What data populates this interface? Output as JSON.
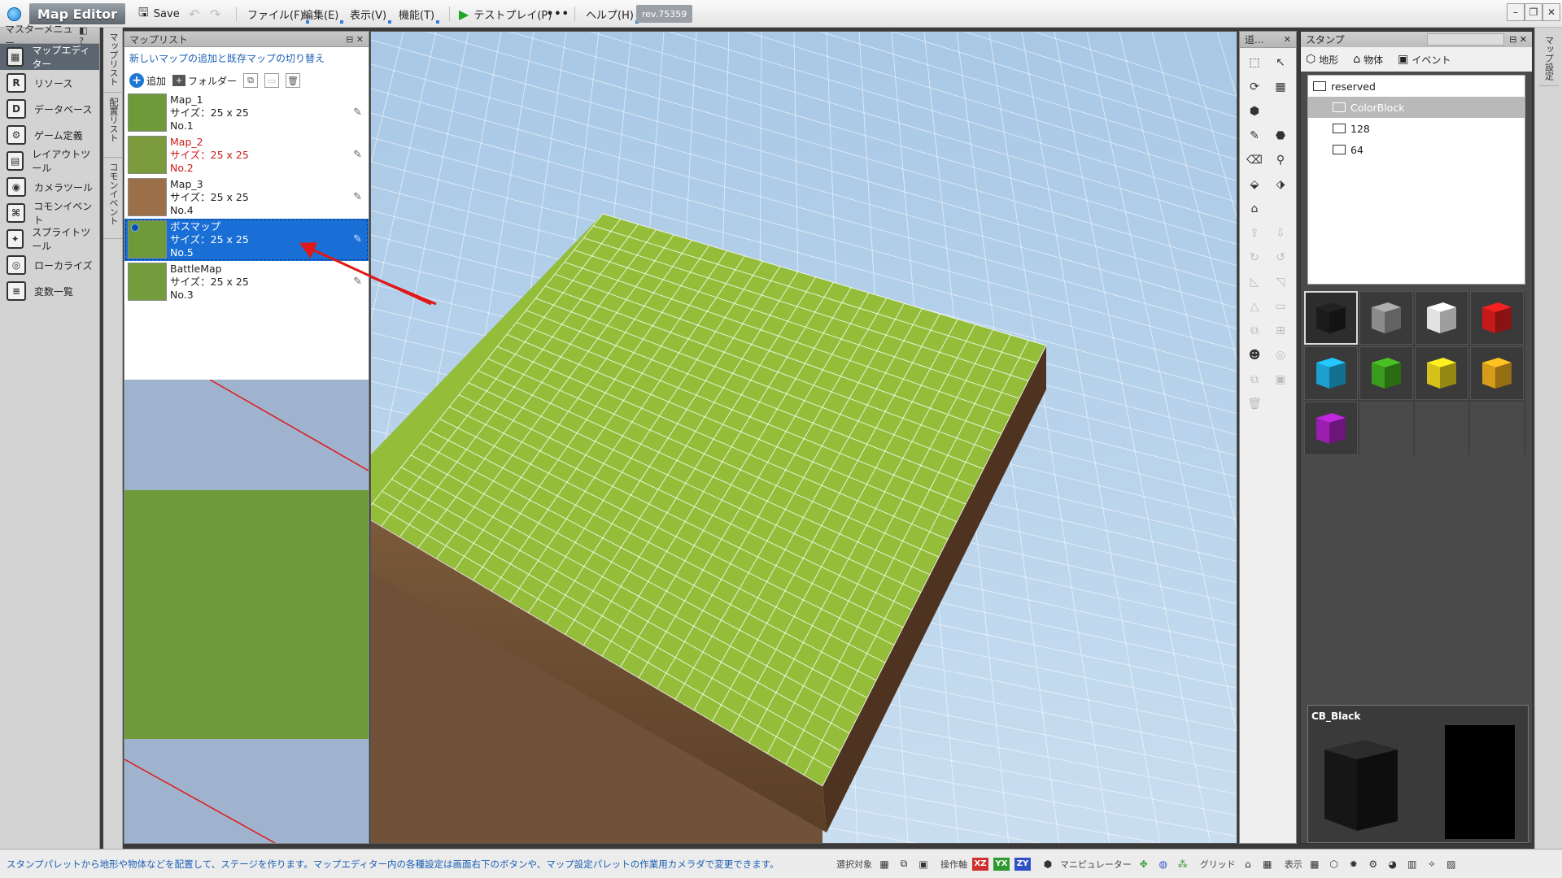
{
  "app": {
    "title": "Map Editor",
    "save_label": "Save",
    "rev": "rev.75359"
  },
  "menu": [
    {
      "label": "ファイル(F)"
    },
    {
      "label": "編集(E)"
    },
    {
      "label": "表示(V)"
    },
    {
      "label": "機能(T)"
    }
  ],
  "testplay_label": "テストプレイ(P)",
  "more_label": "•••",
  "help_label": "ヘルプ(H)",
  "master_menu": {
    "title": "マスターメニュー",
    "items": [
      {
        "label": "マップエディター",
        "icon": "map-editor-icon",
        "glyph": "▦"
      },
      {
        "label": "リソース",
        "icon": "resource-icon",
        "glyph": "R"
      },
      {
        "label": "データベース",
        "icon": "database-icon",
        "glyph": "D"
      },
      {
        "label": "ゲーム定義",
        "icon": "game-definition-icon",
        "glyph": "⚙"
      },
      {
        "label": "レイアウトツール",
        "icon": "layout-tool-icon",
        "glyph": "▤"
      },
      {
        "label": "カメラツール",
        "icon": "camera-tool-icon",
        "glyph": "◉"
      },
      {
        "label": "コモンイベント",
        "icon": "common-event-icon",
        "glyph": "⌘"
      },
      {
        "label": "スプライトツール",
        "icon": "sprite-tool-icon",
        "glyph": "✦"
      },
      {
        "label": "ローカライズ",
        "icon": "localize-icon",
        "glyph": "◎"
      },
      {
        "label": "変数一覧",
        "icon": "variables-icon",
        "glyph": "≡"
      }
    ]
  },
  "vertical_tabs": [
    "マップリスト",
    "配置リスト",
    "コモンイベント"
  ],
  "map_list": {
    "title": "マップリスト",
    "hint": "新しいマップの追加と既存マップの切り替え",
    "add_label": "追加",
    "folder_label": "フォルダー",
    "maps": [
      {
        "name": "Map_1",
        "size": "サイズ：25 x 25",
        "no": "No.1",
        "thumb": "#6f9a3a",
        "state": "normal"
      },
      {
        "name": "Map_2",
        "size": "サイズ：25 x 25",
        "no": "No.2",
        "thumb": "#7a9a3c",
        "state": "red"
      },
      {
        "name": "Map_3",
        "size": "サイズ：25 x 25",
        "no": "No.4",
        "thumb": "#9b7048",
        "state": "normal"
      },
      {
        "name": "ボスマップ",
        "size": "サイズ：25 x 25",
        "no": "No.5",
        "thumb": "#6f9a3a",
        "state": "selected"
      },
      {
        "name": "BattleMap",
        "size": "サイズ：25 x 25",
        "no": "No.3",
        "thumb": "#739c3c",
        "state": "normal"
      }
    ]
  },
  "tools_title": "道...",
  "stamp": {
    "title": "スタンプ",
    "search_placeholder": "",
    "tabs": [
      {
        "label": "地形",
        "icon": "terrain-icon",
        "glyph": "⬡"
      },
      {
        "label": "物体",
        "icon": "object-icon",
        "glyph": "⌂"
      },
      {
        "label": "イベント",
        "icon": "event-icon",
        "glyph": "▣"
      }
    ],
    "tree": [
      {
        "label": "reserved",
        "indent": 0,
        "selected": false
      },
      {
        "label": "ColorBlock",
        "indent": 1,
        "selected": true
      },
      {
        "label": "128",
        "indent": 1,
        "selected": false
      },
      {
        "label": "64",
        "indent": 1,
        "selected": false
      }
    ],
    "cubes": [
      {
        "color": "#1b1b1b",
        "selected": true
      },
      {
        "color": "#8c8c8c"
      },
      {
        "color": "#e2e2e2"
      },
      {
        "color": "#c41a1a"
      },
      {
        "color": "#1ba0cf"
      },
      {
        "color": "#3a9a1c"
      },
      {
        "color": "#d4c11a"
      },
      {
        "color": "#d59c1a"
      },
      {
        "color": "#9a1fb0"
      }
    ],
    "preview_label": "CB_Black"
  },
  "right_tab": "マップ設定",
  "status": {
    "message": "スタンプパレットから地形や物体などを配置して、ステージを作ります。マップエディター内の各種設定は画面右下のボタンや、マップ設定パレットの作業用カメラダで変更できます。",
    "select_target": "選択対象",
    "operation_axis": "操作軸",
    "axes": [
      {
        "label": "XZ",
        "color": "#d03030"
      },
      {
        "label": "YX",
        "color": "#2e9a2e"
      },
      {
        "label": "ZY",
        "color": "#3050c8"
      }
    ],
    "manipulator": "マニピュレーター",
    "grid": "グリッド",
    "display": "表示"
  }
}
